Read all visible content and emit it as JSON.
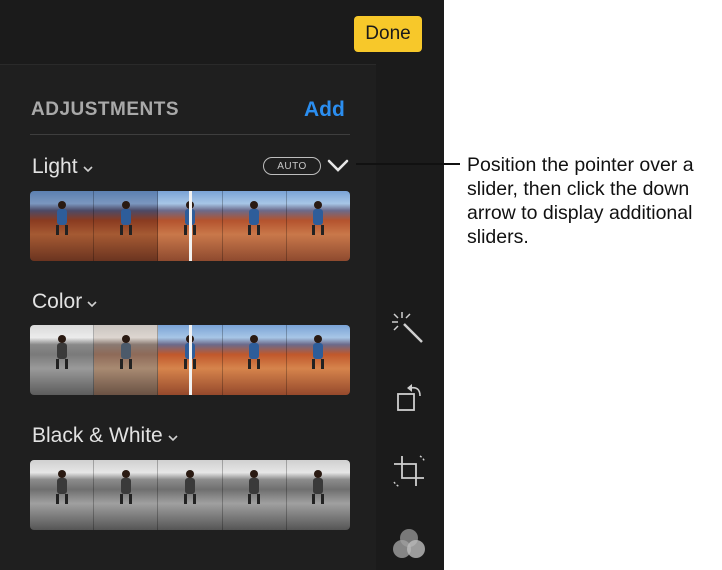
{
  "header": {
    "done_label": "Done"
  },
  "adjustments": {
    "title": "ADJUSTMENTS",
    "add_label": "Add",
    "sections": [
      {
        "label": "Light",
        "auto_label": "AUTO"
      },
      {
        "label": "Color"
      },
      {
        "label": "Black & White"
      }
    ]
  },
  "sidebar": {
    "icons": [
      "magic-wand-icon",
      "rotate-icon",
      "crop-straighten-icon",
      "filters-icon"
    ]
  },
  "callout": {
    "text": "Position the pointer over a slider, then click the down arrow to display additional sliders."
  },
  "colors": {
    "done_button": "#f7c82a",
    "add_link": "#2b8ef0",
    "panel_bg": "#1f1f1f"
  }
}
